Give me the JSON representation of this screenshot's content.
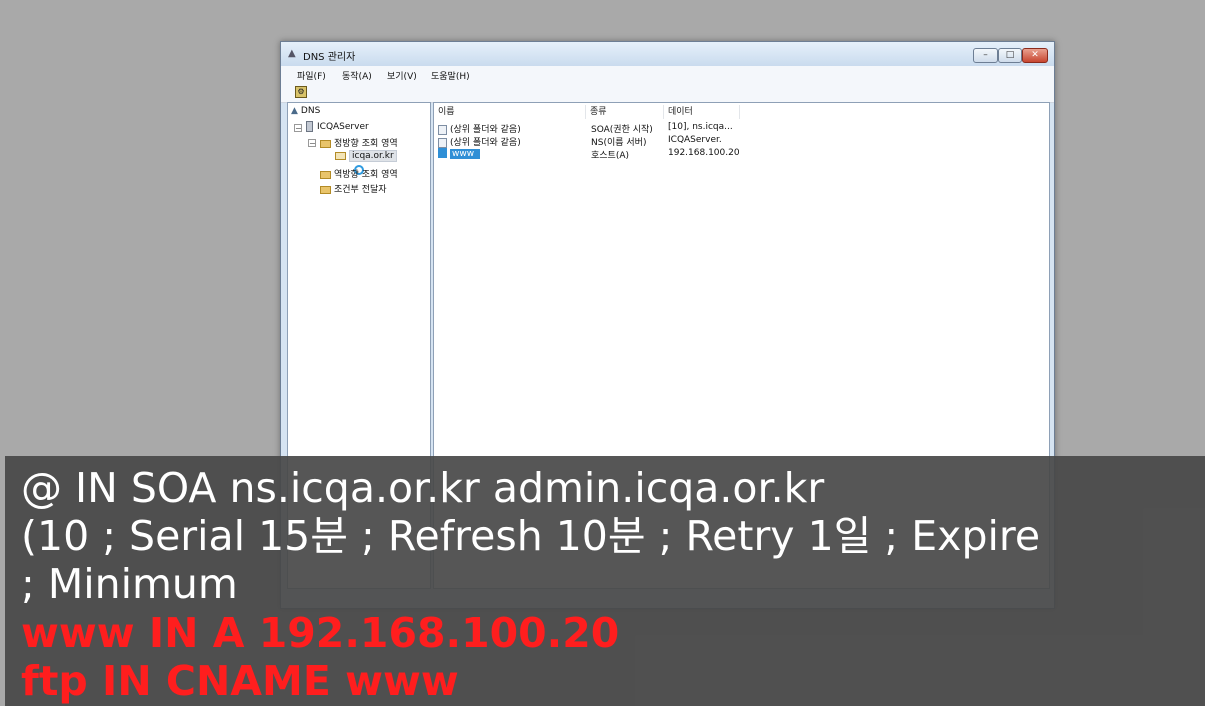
{
  "window": {
    "title": "DNS 관리자",
    "title_icon": "dns-console-icon",
    "buttons": {
      "minimize": "–",
      "maximize": "□",
      "close": "✕"
    }
  },
  "menu": [
    "파일(F)",
    "동작(A)",
    "보기(V)",
    "도움말(H)"
  ],
  "tree": {
    "root": "DNS",
    "server": "ICQAServer",
    "forward_zone": "정방향 조회 영역",
    "zone": "icqa.or.kr",
    "reverse_zone": "역방향 조회 영역",
    "conditional": "조건부 전달자"
  },
  "table": {
    "columns": [
      "이름",
      "종류",
      "데이터"
    ],
    "rows": [
      {
        "name": "(상위 폴더와 같음)",
        "type": "SOA(권한 시작)",
        "data": "[10], ns.icqa...",
        "selected": false
      },
      {
        "name": "(상위 폴더와 같음)",
        "type": "NS(이름 서버)",
        "data": "ICQAServer.",
        "selected": false
      },
      {
        "name": "www",
        "type": "호스트(A)",
        "data": "192.168.100.20",
        "selected": true
      }
    ]
  },
  "subtitles": {
    "line1": "@ IN SOA ns.icqa.or.kr admin.icqa.or.kr",
    "line2": "(10 ; Serial 15분 ; Refresh 10분 ; Retry 1일  ; Expire",
    "line3": "; Minimum",
    "line4": "www IN A 192.168.100.20",
    "line5": "ftp IN CNAME www"
  },
  "colors": {
    "subtitle_white": "#ffffff",
    "subtitle_red": "#ff1e1e",
    "selection": "#2f8fd6"
  }
}
